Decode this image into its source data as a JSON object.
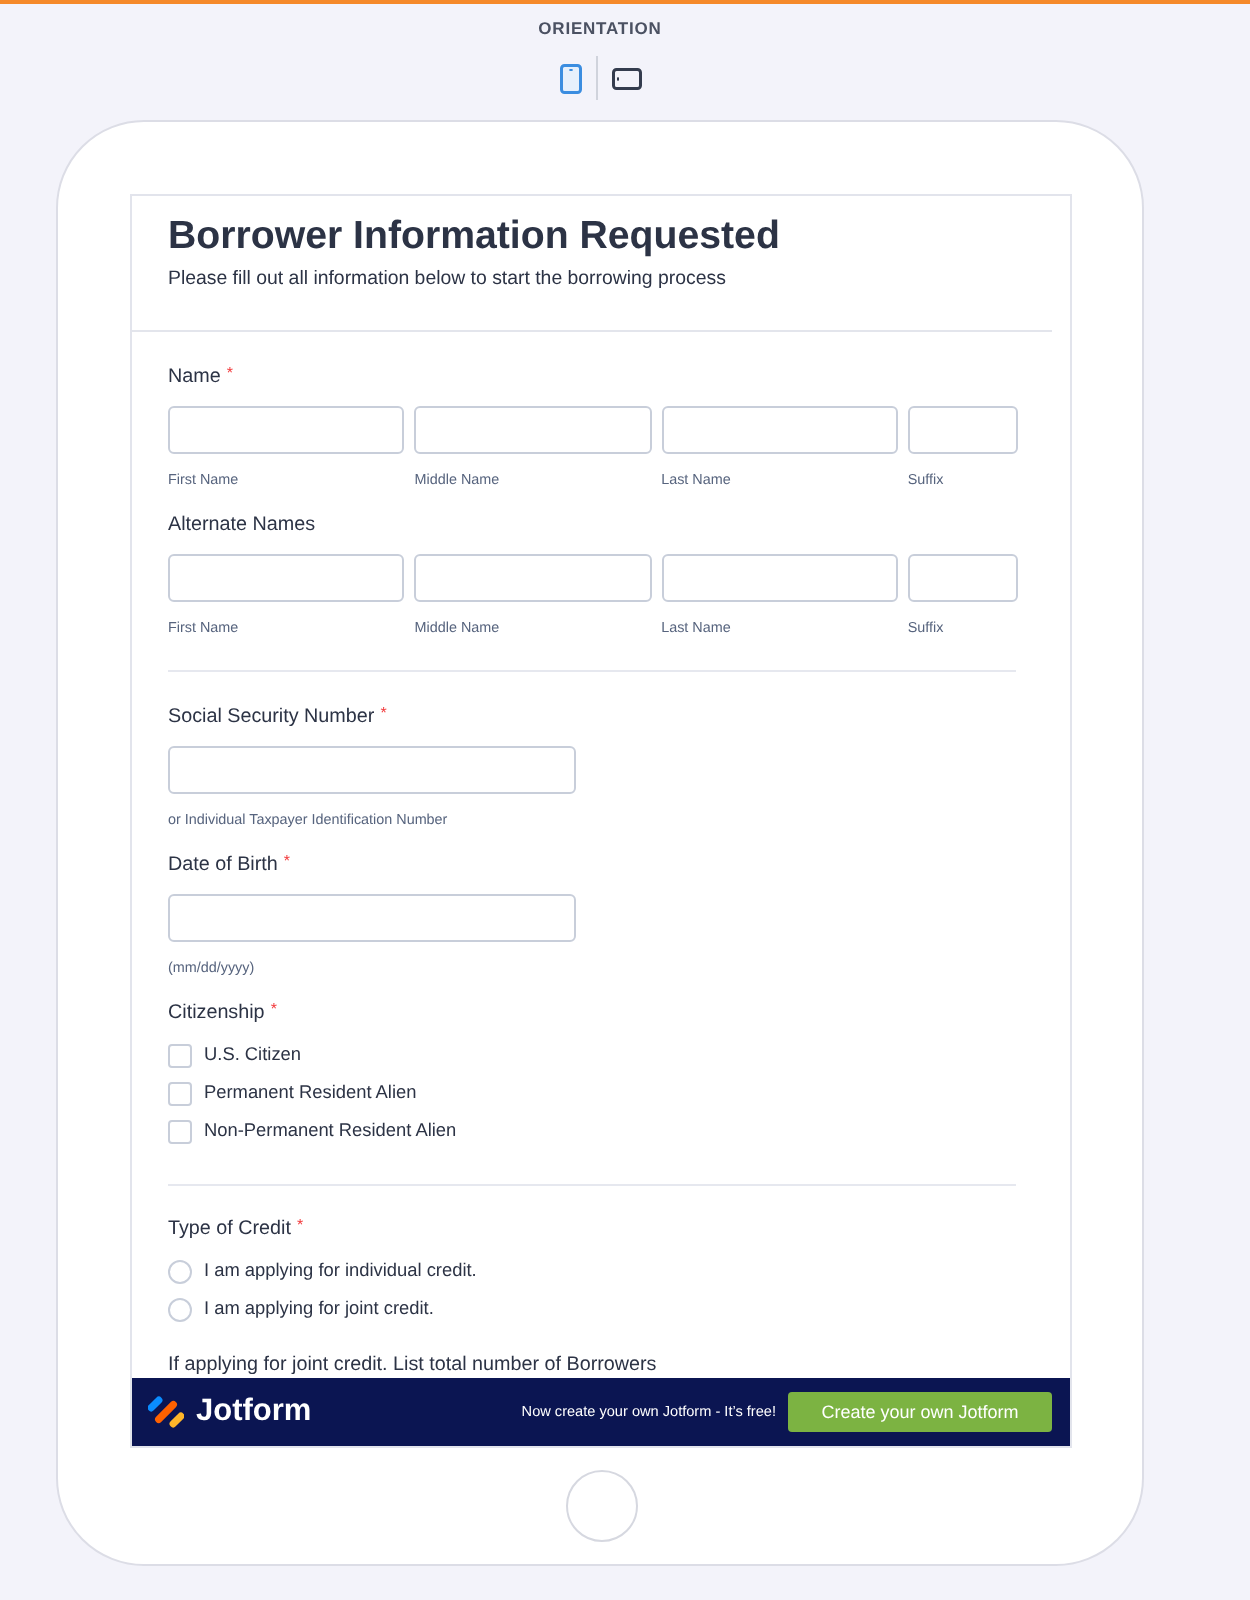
{
  "orientation": {
    "title": "ORIENTATION",
    "options": [
      {
        "kind": "portrait",
        "selected": true
      },
      {
        "kind": "landscape",
        "selected": false
      }
    ]
  },
  "form": {
    "title": "Borrower Information Requested",
    "subtitle": "Please fill out all information below to start the borrowing process",
    "sections": [
      {
        "questions": [
          {
            "kind": "name",
            "label": "Name",
            "required_mark": "*",
            "sublabels": [
              "First Name",
              "Middle Name",
              "Last Name",
              "Suffix"
            ]
          },
          {
            "kind": "name",
            "label": "Alternate Names",
            "sublabels": [
              "First Name",
              "Middle Name",
              "Last Name",
              "Suffix"
            ]
          }
        ]
      },
      {
        "questions": [
          {
            "kind": "text",
            "label": "Social Security Number",
            "required_mark": "*",
            "sublabel": "or Individual Taxpayer Identification Number"
          },
          {
            "kind": "text",
            "label": "Date of Birth",
            "required_mark": "*",
            "sublabel": "(mm/dd/yyyy)"
          },
          {
            "kind": "checkbox",
            "label": "Citizenship",
            "required_mark": "*",
            "options": [
              {
                "label": "U.S. Citizen",
                "checked": false
              },
              {
                "label": "Permanent Resident Alien",
                "checked": false
              },
              {
                "label": "Non-Permanent Resident Alien",
                "checked": false
              }
            ]
          }
        ]
      },
      {
        "questions": [
          {
            "kind": "radio",
            "label": "Type of Credit",
            "required_mark": "*",
            "options": [
              {
                "label": "I am applying for individual credit.",
                "selected": false
              },
              {
                "label": "I am applying for joint credit.",
                "selected": false
              }
            ]
          },
          {
            "kind": "label",
            "label": "If applying for joint credit. List total number of Borrowers"
          }
        ]
      }
    ]
  },
  "banner": {
    "brand": "Jotform",
    "tagline": "Now create your own Jotform - It’s free!",
    "button": "Create your own Jotform"
  }
}
